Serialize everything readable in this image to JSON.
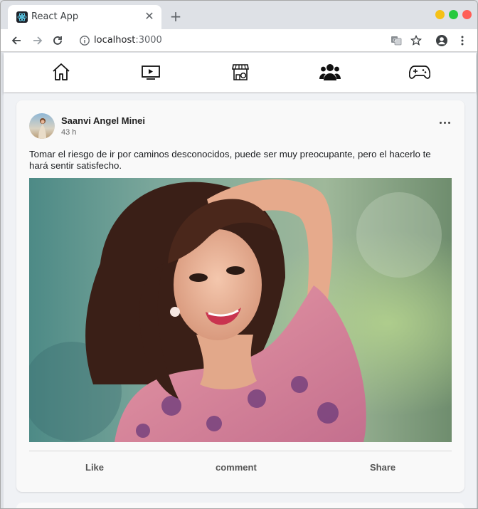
{
  "browser": {
    "tab_title": "React App",
    "url_host": "localhost",
    "url_port": ":3000"
  },
  "nav": {
    "icons": [
      "home-icon",
      "video-icon",
      "marketplace-icon",
      "groups-icon",
      "gaming-icon"
    ],
    "active": "groups-icon"
  },
  "post": {
    "author": "Saanvi Angel Minei",
    "time": "43 h",
    "text": "Tomar el riesgo de ir por caminos desconocidos, puede ser muy preocupante, pero el hacerlo te hará sentir satisfecho.",
    "actions": {
      "like": "Like",
      "comment": "comment",
      "share": "Share"
    }
  },
  "colors": {
    "window_min": "#f5c116",
    "window_max": "#27c93f",
    "window_close": "#ff5f57"
  }
}
